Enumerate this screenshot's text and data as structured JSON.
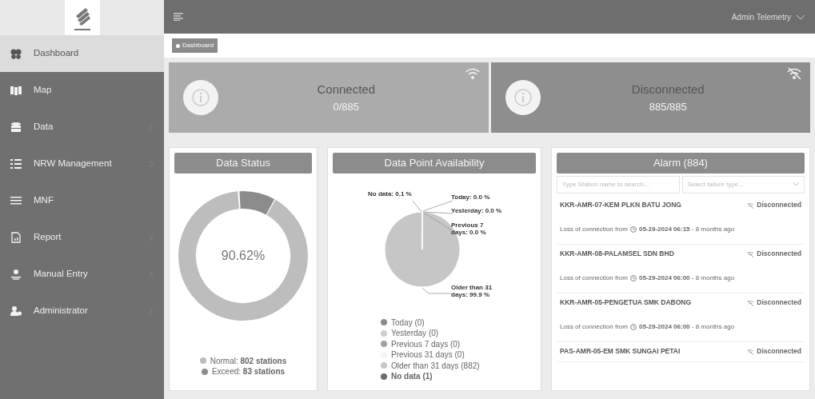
{
  "sidebar": {
    "items": [
      {
        "label": "Dashboard",
        "selected": true,
        "has_caret": false
      },
      {
        "label": "Map",
        "selected": false,
        "has_caret": false
      },
      {
        "label": "Data",
        "selected": false,
        "has_caret": true
      },
      {
        "label": "NRW Management",
        "selected": false,
        "has_caret": true
      },
      {
        "label": "MNF",
        "selected": false,
        "has_caret": false
      },
      {
        "label": "Report",
        "selected": false,
        "has_caret": true
      },
      {
        "label": "Manual Entry",
        "selected": false,
        "has_caret": true
      },
      {
        "label": "Administrator",
        "selected": false,
        "has_caret": true
      }
    ]
  },
  "topbar": {
    "user": "Admin Telemetry"
  },
  "breadcrumb": [
    "Dashboard"
  ],
  "stats": [
    {
      "title": "Connected",
      "value": "0/885",
      "kind": "connected"
    },
    {
      "title": "Disconnected",
      "value": "885/885",
      "kind": "disconnected"
    }
  ],
  "data_status": {
    "title": "Data Status",
    "center": "90.62%",
    "legend": [
      {
        "label": "Normal: **802 stations**",
        "color": "#bdbdbd"
      },
      {
        "label": "Exceed: **83 stations**",
        "color": "#8c8c8c"
      }
    ]
  },
  "availability": {
    "title": "Data Point Availability",
    "chart_data": {
      "type": "pie",
      "categories": [
        "Today",
        "Yesterday",
        "Previous 7 days",
        "Previous 31 days",
        "Older than 31 days",
        "No data"
      ],
      "values": [
        0.0,
        0.0,
        0.0,
        0.0,
        99.9,
        0.1
      ],
      "value_labels": [
        "Today: 0.0 %",
        "Yesterday: 0.0 %",
        "Previous 7 days: 0.0 %",
        null,
        "Older than 31 days: 99.9 %",
        "No data: 0.1 %"
      ]
    },
    "legend": [
      {
        "count": "(0)",
        "color": "#8a8a8a"
      },
      {
        "count": "(0)",
        "color": "#cfcfcf"
      },
      {
        "count": "(0)",
        "color": "#a3a3a3"
      },
      {
        "count": "(0)",
        "color": "#f5f5f5"
      },
      {
        "count": "(882)",
        "color": "#c6c6c6"
      },
      {
        "count": "(1)",
        "color": "#6c6c6c"
      }
    ]
  },
  "alarm": {
    "title": "Alarm (884)",
    "search": {
      "placeholder": "Type Station name to search..."
    },
    "filter": {
      "placeholder": "Select failure type..."
    },
    "items": [
      {
        "name": "KKR-AMR-07-KEM PLKN BATU JONG",
        "status": "Disconnected",
        "message": "Loss of connection from",
        "time": "**05-29-2024 06:15** - 8 months ago"
      },
      {
        "name": "KKR-AMR-08-PALAMSEL SDN BHD",
        "status": "Disconnected",
        "message": "Loss of connection from",
        "time": "**05-29-2024 06:00** - 8 months ago"
      },
      {
        "name": "KKR-AMR-05-PENGETUA SMK DABONG",
        "status": "Disconnected",
        "message": "Loss of connection from",
        "time": "**05-29-2024 06:00** - 8 months ago"
      },
      {
        "name": "PAS-AMR-05-EM SMK SUNGAI PETAI",
        "status": "Disconnected"
      }
    ]
  }
}
